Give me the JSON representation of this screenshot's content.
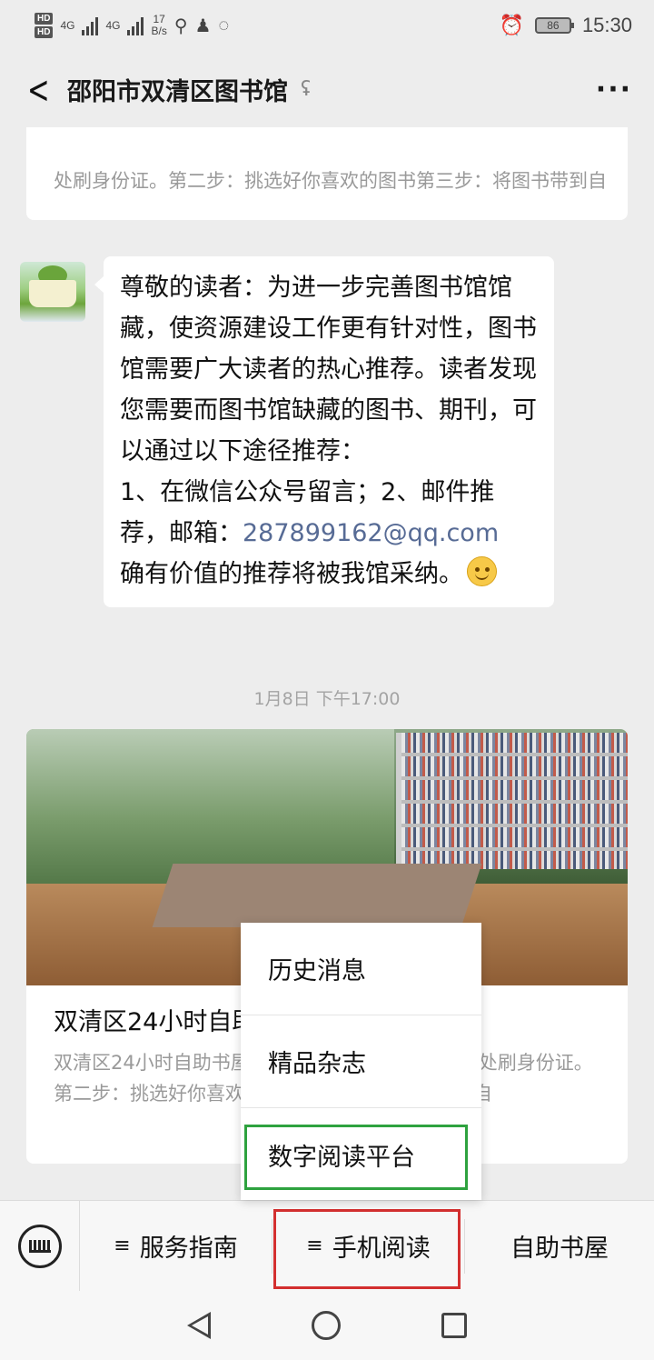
{
  "status_bar": {
    "hd1": "HD",
    "hd2": "HD",
    "net1": "4G",
    "net2": "4G",
    "speed_value": "17",
    "speed_unit": "B/s",
    "battery": "86",
    "time": "15:30"
  },
  "header": {
    "title": "邵阳市双清区图书馆",
    "more": "···"
  },
  "top_card": {
    "description": "处刷身份证。第二步：挑选好你喜欢的图书第三步：将图书带到自"
  },
  "message": {
    "text_main": "尊敬的读者：为进一步完善图书馆馆藏，使资源建设工作更有针对性，图书馆需要广大读者的热心推荐。读者发现您需要而图书馆缺藏的图书、期刊，可以通过以下途径推荐：",
    "text_options": "1、在微信公众号留言；2、邮件推荐，邮箱：",
    "email": "287899162@qq.com",
    "text_end": "确有价值的推荐将被我馆采纳。"
  },
  "timestamp": "1月8日 下午17:00",
  "article": {
    "title": "双清区24小时自助书屋使用方法。",
    "description": "双清区24小时自助书屋使用方法。第一步：在刷卡处刷身份证。第二步：挑选好你喜欢的图书第三步：将图书带到自"
  },
  "popup_menu": {
    "items": [
      {
        "label": "历史消息"
      },
      {
        "label": "精品杂志"
      },
      {
        "label": "数字阅读平台"
      }
    ]
  },
  "menu_bar": {
    "tab1": "服务指南",
    "tab2": "手机阅读",
    "tab3": "自助书屋",
    "menu_glyph": "≡"
  },
  "colors": {
    "link": "#576b95",
    "highlight_green": "#2ea23f",
    "highlight_red": "#d32f2f"
  }
}
